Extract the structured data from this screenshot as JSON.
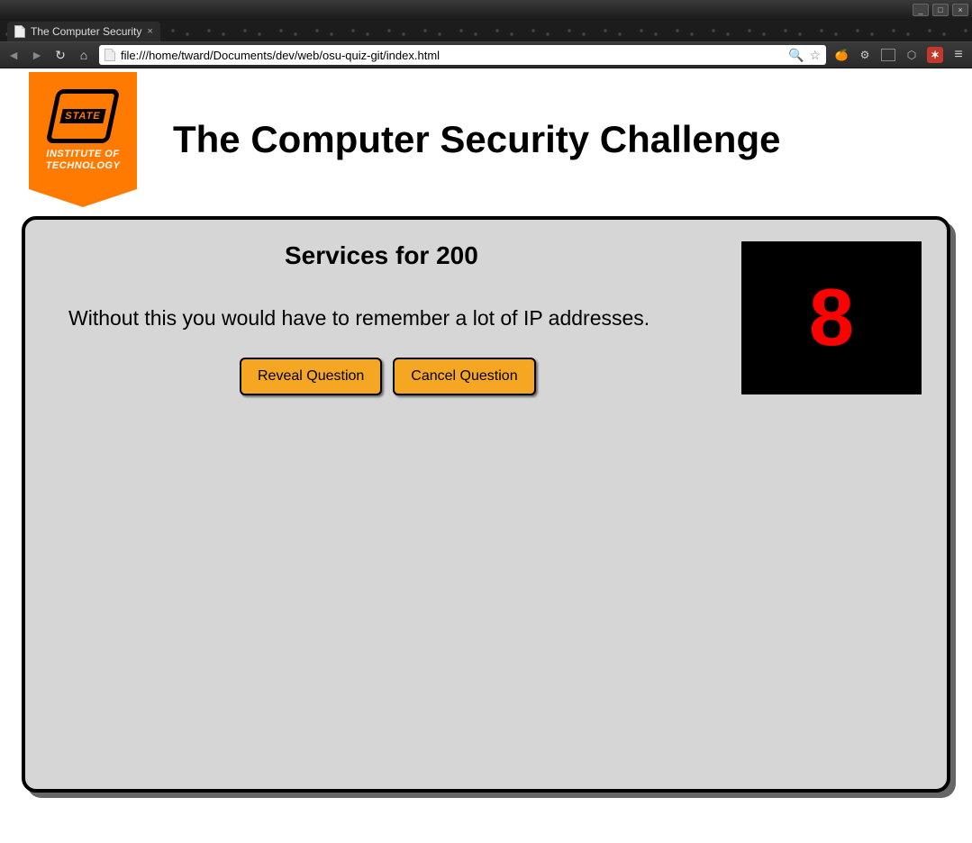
{
  "window": {
    "tab_title": "The Computer Security",
    "minimize": "_",
    "maximize": "□",
    "close": "×"
  },
  "toolbar": {
    "url": "file:///home/tward/Documents/dev/web/osu-quiz-git/index.html"
  },
  "header": {
    "org_state": "STATE",
    "org_sub1": "INSTITUTE OF",
    "org_sub2": "TECHNOLOGY",
    "title": "The Computer Security Challenge"
  },
  "quiz": {
    "category_title": "Services for 200",
    "prompt": "Without this you would have to remember a lot of IP addresses.",
    "reveal_label": "Reveal Question",
    "cancel_label": "Cancel Question",
    "timer_value": "8"
  }
}
